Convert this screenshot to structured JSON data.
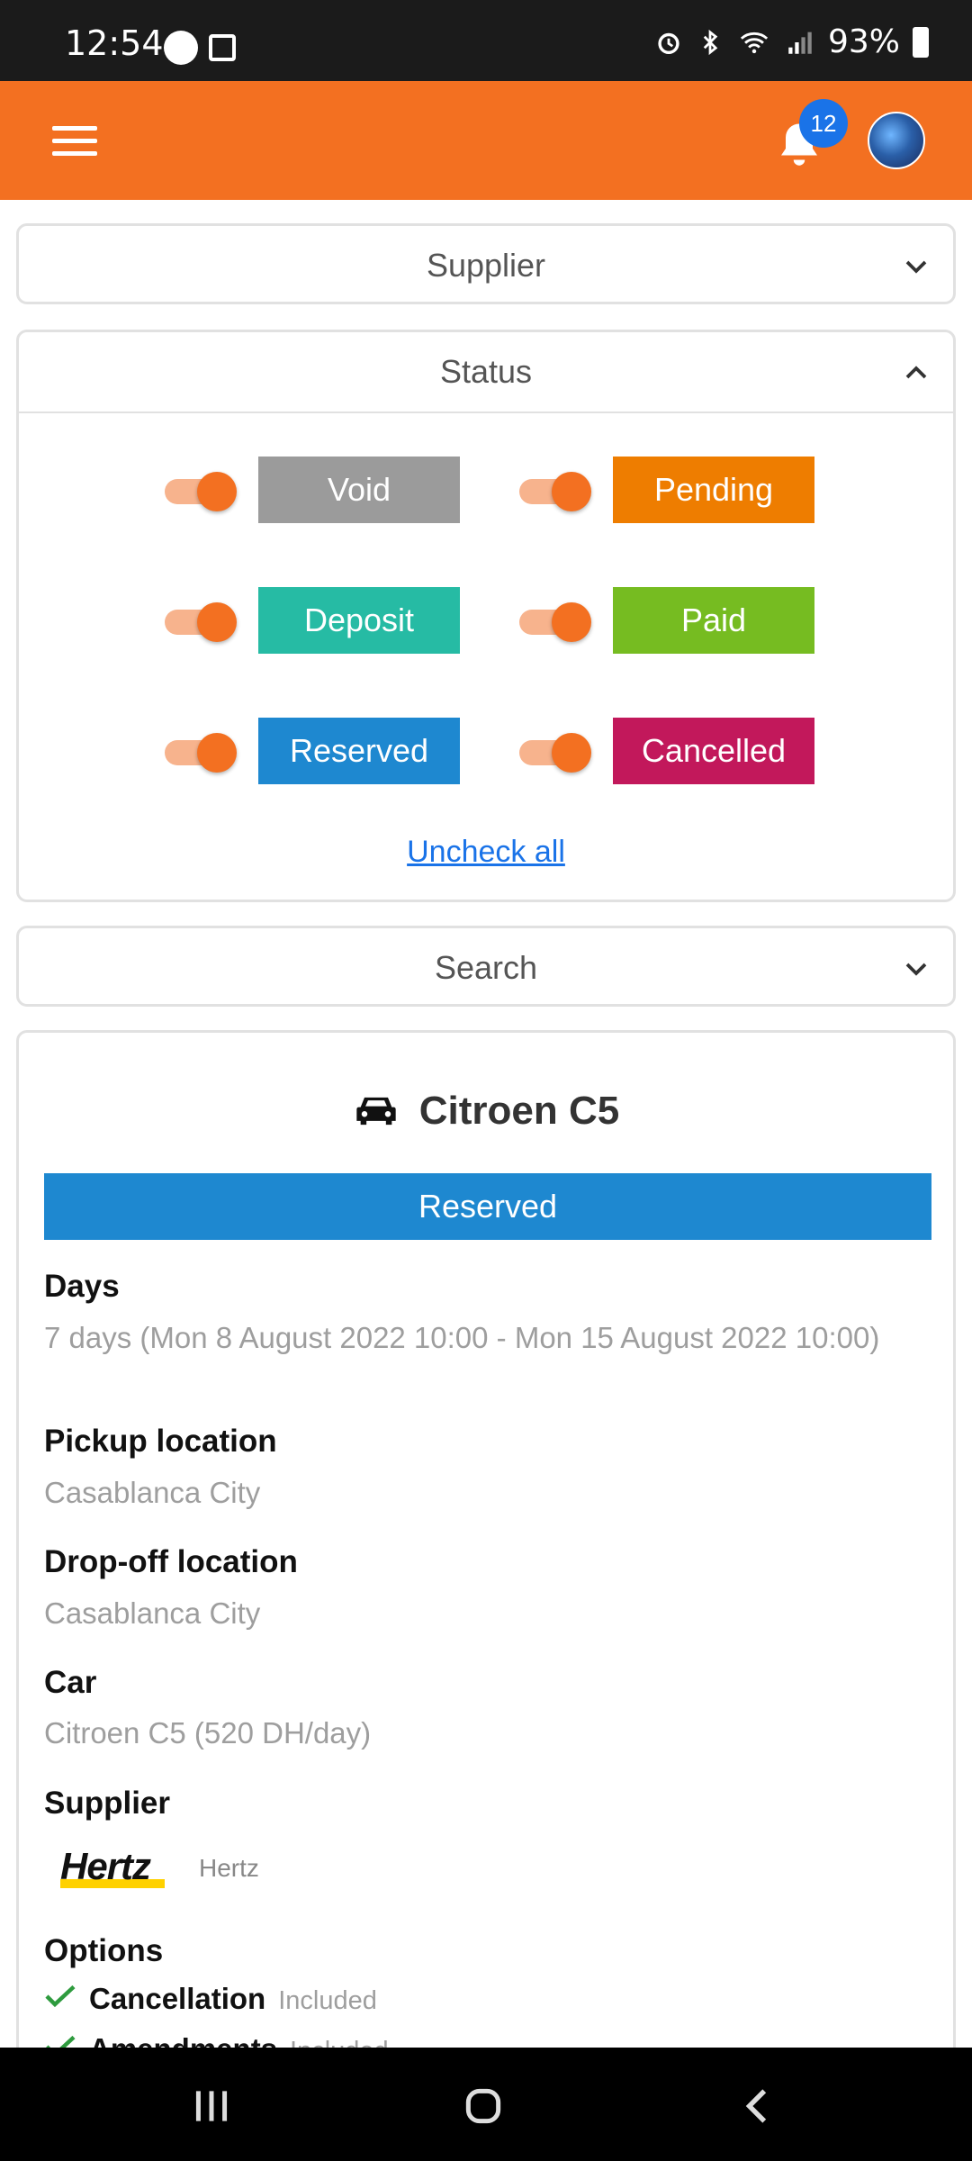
{
  "status_bar": {
    "time": "12:54",
    "battery": "93%"
  },
  "header": {
    "notification_count": "12"
  },
  "filters": {
    "supplier_label": "Supplier",
    "status_label": "Status",
    "search_label": "Search",
    "statuses": [
      {
        "label": "Void",
        "color": "#9b9b9b"
      },
      {
        "label": "Pending",
        "color": "#ee7d00"
      },
      {
        "label": "Deposit",
        "color": "#26bba4"
      },
      {
        "label": "Paid",
        "color": "#76bc21"
      },
      {
        "label": "Reserved",
        "color": "#1e88d0"
      },
      {
        "label": "Cancelled",
        "color": "#c2185b"
      }
    ],
    "uncheck_all": "Uncheck all"
  },
  "booking": {
    "car_title": "Citroen C5",
    "status": "Reserved",
    "status_color": "#1e88d0",
    "days_label": "Days",
    "days_value": "7 days (Mon 8 August 2022 10:00 - Mon 15 August 2022 10:00)",
    "pickup_label": "Pickup location",
    "pickup_value": "Casablanca City",
    "dropoff_label": "Drop-off location",
    "dropoff_value": "Casablanca City",
    "car_label": "Car",
    "car_value": "Citroen C5 (520  DH/day)",
    "supplier_label": "Supplier",
    "supplier_logo_text": "Hertz",
    "supplier_name": "Hertz",
    "options_label": "Options",
    "options": [
      {
        "name": "Cancellation",
        "value": "Included"
      },
      {
        "name": "Amendments",
        "value": "Included"
      }
    ]
  },
  "theme": {
    "accent": "#f37021",
    "link": "#1a73e8"
  }
}
